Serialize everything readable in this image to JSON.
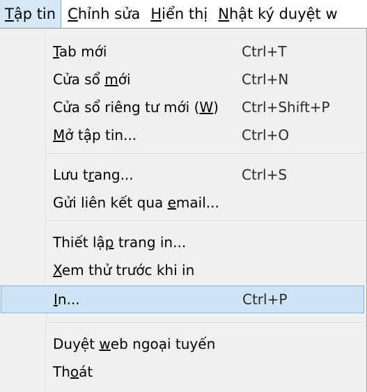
{
  "menubar": {
    "items": [
      {
        "first": "T",
        "rest": "ập tin"
      },
      {
        "first": "C",
        "rest": "hỉnh sửa"
      },
      {
        "first": "H",
        "rest": "iển thị"
      },
      {
        "first": "N",
        "rest": "hật ký duyệt w"
      }
    ]
  },
  "menu": {
    "items": [
      {
        "pre": "",
        "acc": "T",
        "post": "ab mới",
        "shortcut": "Ctrl+T"
      },
      {
        "pre": "Cửa sổ ",
        "acc": "m",
        "post": "ới",
        "shortcut": "Ctrl+N"
      },
      {
        "pre": "Cửa sổ riêng tư mới (",
        "acc": "W",
        "post": ")",
        "shortcut": "Ctrl+Shift+P"
      },
      {
        "pre": "",
        "acc": "M",
        "post": "ở tập tin...",
        "shortcut": "Ctrl+O"
      },
      {
        "pre": "Lưu t",
        "acc": "r",
        "post": "ang...",
        "shortcut": "Ctrl+S"
      },
      {
        "pre": "Gửi liên kết qua ",
        "acc": "e",
        "post": "mail...",
        "shortcut": ""
      },
      {
        "pre": "Thiết lậ",
        "acc": "p",
        "post": " trang in...",
        "shortcut": ""
      },
      {
        "pre": "",
        "acc": "X",
        "post": "em thử trước khi in",
        "shortcut": ""
      },
      {
        "pre": "",
        "acc": "I",
        "post": "n...",
        "shortcut": "Ctrl+P"
      },
      {
        "pre": "Duyệt ",
        "acc": "w",
        "post": "eb ngoại tuyến",
        "shortcut": ""
      },
      {
        "pre": "Th",
        "acc": "o",
        "post": "át",
        "shortcut": ""
      }
    ]
  }
}
